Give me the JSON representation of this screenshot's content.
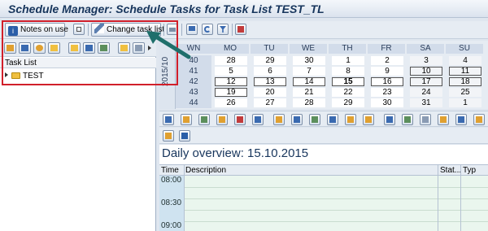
{
  "window": {
    "title": "Schedule Manager: Schedule Tasks for Task List TEST_TL"
  },
  "toolbar": {
    "notes_label": "Notes on use",
    "change_task_list_label": "Change task list"
  },
  "left_panel": {
    "tree_header": "Task List",
    "items": [
      {
        "label": "TEST"
      }
    ]
  },
  "calendar": {
    "year_label": "2015/10",
    "week_header": "WN",
    "day_headers": [
      "MO",
      "TU",
      "WE",
      "TH",
      "FR",
      "SA",
      "SU"
    ],
    "weeks": [
      {
        "wn": "40",
        "days": [
          "28",
          "29",
          "30",
          "1",
          "2",
          "3",
          "4"
        ]
      },
      {
        "wn": "41",
        "days": [
          "5",
          "6",
          "7",
          "8",
          "9",
          "10",
          "11"
        ]
      },
      {
        "wn": "42",
        "days": [
          "12",
          "13",
          "14",
          "15",
          "16",
          "17",
          "18"
        ]
      },
      {
        "wn": "43",
        "days": [
          "19",
          "20",
          "21",
          "22",
          "23",
          "24",
          "25"
        ]
      },
      {
        "wn": "44",
        "days": [
          "26",
          "27",
          "28",
          "29",
          "30",
          "31",
          "1"
        ]
      }
    ],
    "selected_day": "15"
  },
  "daily": {
    "title": "Daily overview: 15.10.2015",
    "columns": {
      "time": "Time",
      "description": "Description",
      "status": "Stat...",
      "type": "Typ"
    },
    "times": [
      "08:00",
      "08:30",
      "09:00"
    ]
  },
  "colors": {
    "highlight": "#d11f2a",
    "title": "#17355c",
    "time_column": "#cfe3f0",
    "schedule_body": "#eaf6ee"
  }
}
